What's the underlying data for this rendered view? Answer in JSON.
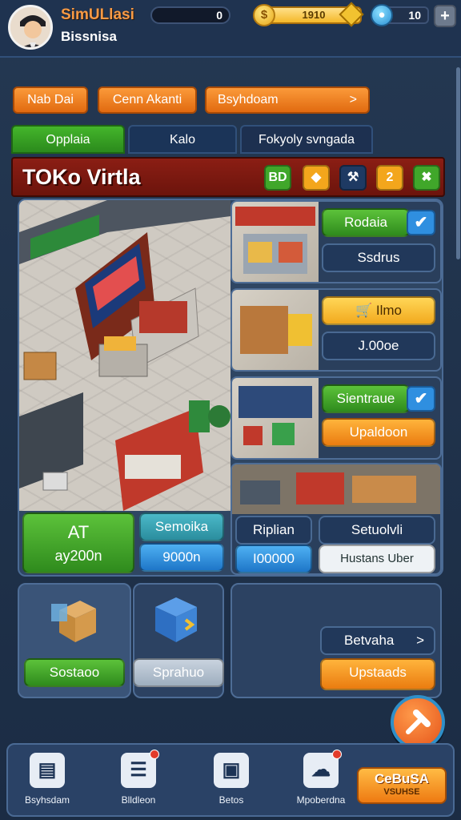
{
  "header": {
    "title": "SimULlasi",
    "subtitle": "Bissnisa",
    "xp_value": "0",
    "coin_symbol": "$",
    "coins": "1910",
    "gems": "10",
    "plus": "+"
  },
  "action_buttons": {
    "b1": "Nab Dai",
    "b2": "Cenn Akanti",
    "b3": "Bsyhdoam",
    "chevron": ">"
  },
  "tabs": [
    "Opplaia",
    "Kalo",
    "Fokyoly svngada"
  ],
  "banner": {
    "title": "TOKo Virtla",
    "icons": [
      "BD",
      "◆",
      "⚒",
      "2",
      "✖"
    ]
  },
  "panels": {
    "p1": {
      "top_label": "Rodaia",
      "bottom_label": "Ssdrus",
      "check": "✔"
    },
    "p2": {
      "top_label": "Ilmo",
      "bottom_label": "J.00oe"
    },
    "p3": {
      "top_label": "Sientraue",
      "bottom_label": "Upaldoon",
      "check": "✔"
    },
    "scene_buttons": {
      "at_title": "AT",
      "at_value": "ay200n",
      "teal_label": "Semoika",
      "blue_value": "9000n"
    },
    "p4": {
      "left_label": "Riplian",
      "left_value": "I00000",
      "right_label": "Setuolvli",
      "right_value": "Hustans Uber"
    }
  },
  "cards": {
    "c1_button": "Sostaoo",
    "c2_button": "Sprahuo",
    "c3_btn1": "Betvaha",
    "c3_btn1_chevron": ">",
    "c3_btn2": "Upstaads"
  },
  "fab_icon": "hammer-icon",
  "nav": {
    "items": [
      {
        "label": "Bsyhsdam",
        "icon": "store-icon"
      },
      {
        "label": "Blldleon",
        "icon": "clipboard-icon"
      },
      {
        "label": "Betos",
        "icon": "boxes-icon"
      },
      {
        "label": "Mpoberdna",
        "icon": "chat-icon"
      }
    ],
    "cta_line1": "CeBuSA",
    "cta_line2": "VSUHSE"
  },
  "colors": {
    "accent_orange": "#f08a22",
    "accent_green": "#3fa52a",
    "banner_red": "#7a1a10",
    "panel_navy": "#2a3f5c"
  }
}
